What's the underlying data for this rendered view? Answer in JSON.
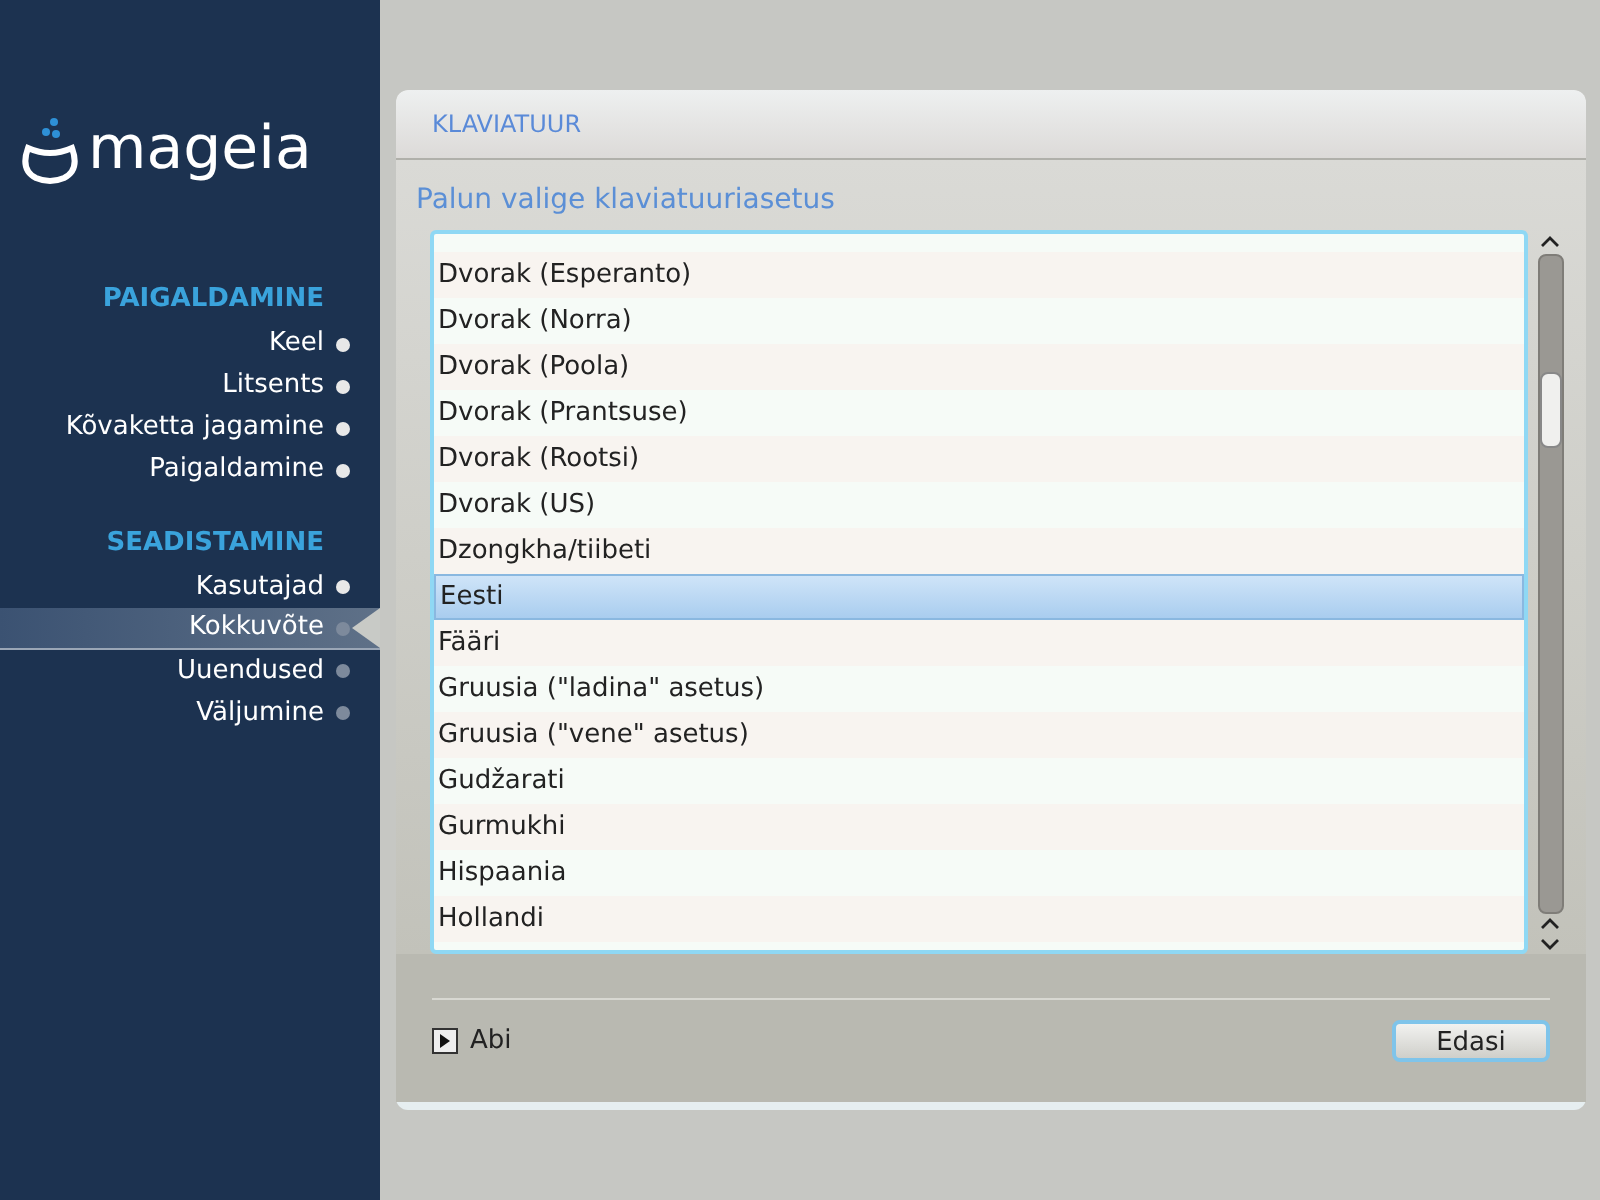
{
  "logo": {
    "text": "mageia"
  },
  "sidebar": {
    "sections": [
      {
        "title": "PAIGALDAMINE",
        "items": [
          {
            "label": "Keel",
            "selected": false,
            "done": true
          },
          {
            "label": "Litsents",
            "selected": false,
            "done": true
          },
          {
            "label": "Kõvaketta jagamine",
            "selected": false,
            "done": true
          },
          {
            "label": "Paigaldamine",
            "selected": false,
            "done": true
          }
        ]
      },
      {
        "title": "SEADISTAMINE",
        "items": [
          {
            "label": "Kasutajad",
            "selected": false,
            "done": true
          },
          {
            "label": "Kokkuvõte",
            "selected": true,
            "done": false
          },
          {
            "label": "Uuendused",
            "selected": false,
            "done": false
          },
          {
            "label": "Väljumine",
            "selected": false,
            "done": false
          }
        ]
      }
    ]
  },
  "panel": {
    "title": "KLAVIATUUR",
    "prompt": "Palun valige klaviatuuriasetus",
    "list": [
      {
        "label": "Dvorak (Esperanto)",
        "selected": false
      },
      {
        "label": "Dvorak (Norra)",
        "selected": false
      },
      {
        "label": "Dvorak (Poola)",
        "selected": false
      },
      {
        "label": "Dvorak (Prantsuse)",
        "selected": false
      },
      {
        "label": "Dvorak (Rootsi)",
        "selected": false
      },
      {
        "label": "Dvorak (US)",
        "selected": false
      },
      {
        "label": "Dzongkha/tiibeti",
        "selected": false
      },
      {
        "label": "Eesti",
        "selected": true
      },
      {
        "label": "Fääri",
        "selected": false
      },
      {
        "label": "Gruusia (\"ladina\" asetus)",
        "selected": false
      },
      {
        "label": "Gruusia (\"vene\" asetus)",
        "selected": false
      },
      {
        "label": "Gudžarati",
        "selected": false
      },
      {
        "label": "Gurmukhi",
        "selected": false
      },
      {
        "label": "Hispaania",
        "selected": false
      },
      {
        "label": "Hollandi",
        "selected": false
      }
    ],
    "help": {
      "label": "Abi",
      "expanded": false
    },
    "buttons": [
      "Edasi"
    ]
  }
}
